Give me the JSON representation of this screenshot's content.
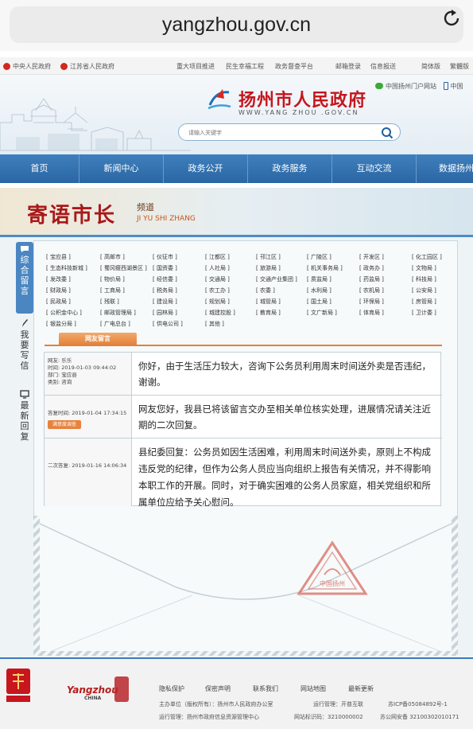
{
  "browser": {
    "url": "yangzhou.gov.cn"
  },
  "topbar": {
    "left": [
      "中央人民政府",
      "江苏省人民政府"
    ],
    "right": [
      "重大项目推进",
      "民生幸福工程",
      "政务督查平台",
      "邮箱登录",
      "信息报送",
      "简体版",
      "繁體版"
    ]
  },
  "header": {
    "title": "扬州市人民政府",
    "url_text": "WWW.YANG ZHOU .GOV.CN",
    "links": [
      "中国扬州门户网站",
      "中国"
    ],
    "search_placeholder": "请输入关键字"
  },
  "nav": [
    "首页",
    "新闻中心",
    "政务公开",
    "政务服务",
    "互动交流",
    "数据扬州"
  ],
  "banner": {
    "title": "寄语市长",
    "sub": "频道",
    "pinyin": "JI YU SHI ZHANG"
  },
  "side_tabs": [
    "综合留言",
    "我要写信",
    "最新回复"
  ],
  "departments": [
    [
      "[ 宝应县 ]",
      "[ 高邮市 ]",
      "[ 仪征市 ]",
      "[ 江都区 ]",
      "[ 邗江区 ]",
      "[ 广陵区 ]",
      "[ 开发区 ]",
      "[ 化工园区 ]"
    ],
    [
      "[ 生态科技新城 ]",
      "[ 蜀冈瘦西湖景区 ]",
      "[ 国资委 ]",
      "[ 人社局 ]",
      "[ 旅游局 ]",
      "[ 机关事务局 ]",
      "[ 政务办 ]",
      "[ 文物局 ]"
    ],
    [
      "[ 发改委 ]",
      "[ 物价局 ]",
      "[ 经信委 ]",
      "[ 交通局 ]",
      "[ 交通产业集团 ]",
      "[ 质监局 ]",
      "[ 药监局 ]",
      "[ 科技局 ]"
    ],
    [
      "[ 财政局 ]",
      "[ 工商局 ]",
      "[ 税务局 ]",
      "[ 农工办 ]",
      "[ 农委 ]",
      "[ 水利局 ]",
      "[ 农机局 ]",
      "[ 公安局 ]"
    ],
    [
      "[ 民政局 ]",
      "[ 残联 ]",
      "[ 建设局 ]",
      "[ 规划局 ]",
      "[ 城管局 ]",
      "[ 国土局 ]",
      "[ 环保局 ]",
      "[ 房管局 ]"
    ],
    [
      "[ 公积金中心 ]",
      "[ 邮政管理局 ]",
      "[ 园林局 ]",
      "[ 城建控股 ]",
      "[ 教育局 ]",
      "[ 文广新局 ]",
      "[ 体育局 ]",
      "[ 卫计委 ]"
    ],
    [
      "[ 银监分局 ]",
      "[ 广电总台 ]",
      "[ 供电公司 ]",
      "[ 其他 ]"
    ]
  ],
  "section_tab": "网友留言",
  "messages": [
    {
      "meta": [
        "网友: 乐乐",
        "时间: 2019-01-03 09:44:02",
        "部门: 宝应县",
        "类别: 咨询"
      ],
      "text": "你好，由于生活压力较大，咨询下公务员利用周末时间送外卖是否违纪，谢谢。"
    },
    {
      "meta": [
        "答复时间: 2019-01-04 17:34:15"
      ],
      "badge": "满意度调查",
      "text": "网友您好，我县已将该留言交办至相关单位核实处理，进展情况请关注近期的二次回复。"
    },
    {
      "meta": [
        "二次答复: 2019-01-16 14:06:34"
      ],
      "text": "县纪委回复：公务员如因生活困难，利用周末时间送外卖，原则上不构成违反党的纪律，但作为公务人员应当向组织上报告有关情况，并不得影响本职工作的开展。同时，对于确实困难的公务人员家庭，相关党组织和所属单位应给予关心慰问。"
    }
  ],
  "stamp_text": "中国扬州",
  "footer": {
    "logo2": "Yangzhou",
    "logo2_sub": "CHINA",
    "links": [
      "隐私保护",
      "保密声明",
      "联系我们",
      "网站地图",
      "最新更新"
    ],
    "line1": "主办单位（版权所有）：扬州市人民政府办公室",
    "line1b": "运行管理：开普互联",
    "line1c": "苏ICP备05084892号-1",
    "line2": "运行管理：扬州市政府信息资源管理中心",
    "line2b": "网站标识码：3210000002",
    "line2c": "苏公网安备 32100302010171"
  },
  "colors": {
    "nav": "#2f6ead",
    "title_red": "#c5161d",
    "accent_orange": "#e2803a"
  }
}
